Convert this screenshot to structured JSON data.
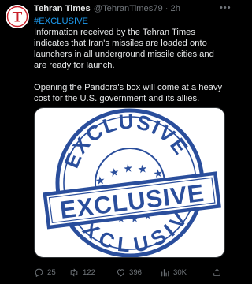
{
  "account": {
    "name": "Tehran Times",
    "handle": "@TehranTimes79",
    "separator": "·",
    "time": "2h",
    "avatar_letter": "T",
    "avatar_colors": {
      "background": "#ffffff",
      "letter": "#c8202a"
    }
  },
  "post": {
    "hashtag": "#EXCLUSIVE",
    "paragraph1": "Information received by the Tehran Times indicates that Iran's missiles are loaded onto launchers in all underground missile cities and are ready for launch.",
    "paragraph2": "Opening the Pandora's box will come at a heavy cost for the U.S. government and its allies."
  },
  "media": {
    "stamp_text": "EXCLUSIVE",
    "stamp_color": "#2a4e9c",
    "background": "#ffffff"
  },
  "actions": {
    "replies": "25",
    "reposts": "122",
    "likes": "396",
    "views": "30K",
    "icons": [
      "reply-icon",
      "repost-icon",
      "like-icon",
      "views-icon",
      "share-icon"
    ]
  },
  "colors": {
    "background": "#000000",
    "text": "#e7e9ea",
    "muted": "#71767b",
    "link": "#1d9bf0"
  }
}
